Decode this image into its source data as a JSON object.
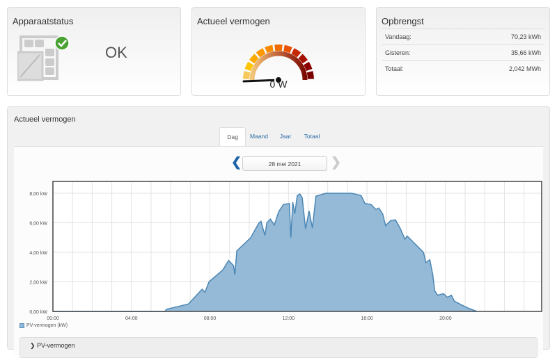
{
  "status_card": {
    "title": "Apparaatstatus",
    "value": "OK",
    "icon": "inverter-ok-icon"
  },
  "power_card": {
    "title": "Actueel vermogen",
    "value": "0 W",
    "gauge_fraction": 0
  },
  "yield_card": {
    "title": "Opbrengst",
    "rows": [
      {
        "label": "Vandaag:",
        "value": "70,23 kWh"
      },
      {
        "label": "Gisteren:",
        "value": "35,66 kWh"
      },
      {
        "label": "Totaal:",
        "value": "2,042 MWh"
      }
    ]
  },
  "panel": {
    "title": "Actueel vermogen",
    "tabs": [
      {
        "label": "Dag",
        "active": true
      },
      {
        "label": "Maand"
      },
      {
        "label": "Jaar"
      },
      {
        "label": "Totaal"
      }
    ],
    "date": "28 mei 2021",
    "sub_section": "PV-vermogen"
  },
  "colors": {
    "accent": "#2a6aa8",
    "series_fill": "#8fb6d5",
    "series_line": "#4a86b4"
  },
  "chart_data": {
    "type": "area",
    "title": "",
    "xlabel": "",
    "ylabel": "",
    "x_ticks": [
      "00:00",
      "04:00",
      "08:00",
      "12:00",
      "16:00",
      "20:00"
    ],
    "y_ticks": [
      "0,00 kW",
      "2,00 kW",
      "4,00 kW",
      "6,00 kW",
      "8,00 kW"
    ],
    "xlim_hours": [
      0,
      24.9
    ],
    "ylim": [
      0,
      8.8
    ],
    "grid": true,
    "legend": "bottom-left",
    "series": [
      {
        "name": "PV-vermogen (kW)",
        "points": [
          [
            0,
            0
          ],
          [
            5.7,
            0
          ],
          [
            5.8,
            0.15
          ],
          [
            6.9,
            0.5
          ],
          [
            7.6,
            1.5
          ],
          [
            7.75,
            1.3
          ],
          [
            7.95,
            2.0
          ],
          [
            8.65,
            2.8
          ],
          [
            8.95,
            3.45
          ],
          [
            9.2,
            3.1
          ],
          [
            9.27,
            2.5
          ],
          [
            9.37,
            4.1
          ],
          [
            10.08,
            5.0
          ],
          [
            10.5,
            6.0
          ],
          [
            10.6,
            6.1
          ],
          [
            10.8,
            5.15
          ],
          [
            10.9,
            6.0
          ],
          [
            11.08,
            6.25
          ],
          [
            11.28,
            5.85
          ],
          [
            11.5,
            6.75
          ],
          [
            11.75,
            7.25
          ],
          [
            12.05,
            7.3
          ],
          [
            12.12,
            5.0
          ],
          [
            12.22,
            7.4
          ],
          [
            12.32,
            6.6
          ],
          [
            12.45,
            7.85
          ],
          [
            12.58,
            7.95
          ],
          [
            12.7,
            7.7
          ],
          [
            12.87,
            5.6
          ],
          [
            13.05,
            6.8
          ],
          [
            13.22,
            5.65
          ],
          [
            13.4,
            7.8
          ],
          [
            13.65,
            7.9
          ],
          [
            13.9,
            8.0
          ],
          [
            15.2,
            8.0
          ],
          [
            15.7,
            7.85
          ],
          [
            15.9,
            7.3
          ],
          [
            16.2,
            7.25
          ],
          [
            16.45,
            6.9
          ],
          [
            16.6,
            7.0
          ],
          [
            16.8,
            6.6
          ],
          [
            16.95,
            5.8
          ],
          [
            17.2,
            6.15
          ],
          [
            17.45,
            6.2
          ],
          [
            17.7,
            5.6
          ],
          [
            17.93,
            4.9
          ],
          [
            18.05,
            5.1
          ],
          [
            18.88,
            4.0
          ],
          [
            19.0,
            3.3
          ],
          [
            19.2,
            3.5
          ],
          [
            19.35,
            2.5
          ],
          [
            19.45,
            1.4
          ],
          [
            19.6,
            1.1
          ],
          [
            19.9,
            1.2
          ],
          [
            20.1,
            0.95
          ],
          [
            20.3,
            1.1
          ],
          [
            20.45,
            0.7
          ],
          [
            20.8,
            0.45
          ],
          [
            21.2,
            0.2
          ],
          [
            21.6,
            0
          ]
        ]
      }
    ]
  }
}
